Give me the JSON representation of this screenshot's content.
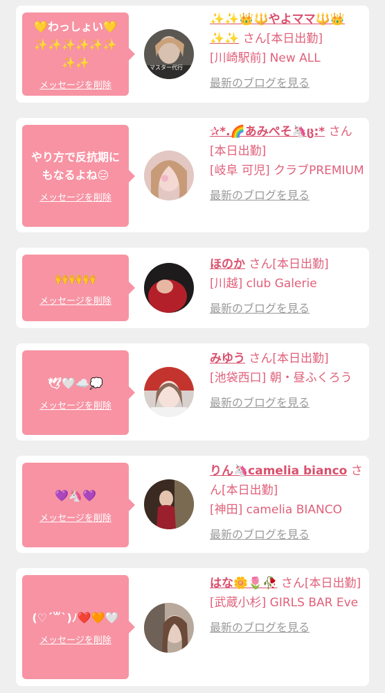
{
  "delete_label": "メッセージを削除",
  "blog_label": "最新のブログを見る",
  "items": [
    {
      "message": "💛わっしょい💛✨✨✨✨✨✨✨✨",
      "name": "✨✨👑🔱やよママ🔱👑✨✨",
      "san": "さん[本日出勤]",
      "shop": "[川崎駅前] New ALL",
      "avatar_text": "マスター代行"
    },
    {
      "message": "やり方で反抗期にもなるよね😑",
      "name": "✰*.🌈あみぺそ🦄ც:*",
      "san": "さん[本日出勤]",
      "shop": "[岐阜 可児] クラブPREMIUM"
    },
    {
      "message": "🙌🙌🙌",
      "name": "ほのか",
      "san": "さん[本日出勤]",
      "shop": "[川越] club Galerie"
    },
    {
      "message": "🕊🤍☁️💭",
      "name": "みゆう",
      "san": "さん[本日出勤]",
      "shop": "[池袋西口] 朝・昼ふくろう"
    },
    {
      "message": "💜🦄💜",
      "name": "りん🦄camelia bianco",
      "san": "さん[本日出勤]",
      "shop": "[神田] camelia BIANCO"
    },
    {
      "message": "(♡ˊ꒳ˋ)ﾉ❤️🧡🤍",
      "name": "はな🌼🌷🥀",
      "san": "さん[本日出勤]",
      "shop": "[武蔵小杉] GIRLS BAR Eve"
    }
  ]
}
